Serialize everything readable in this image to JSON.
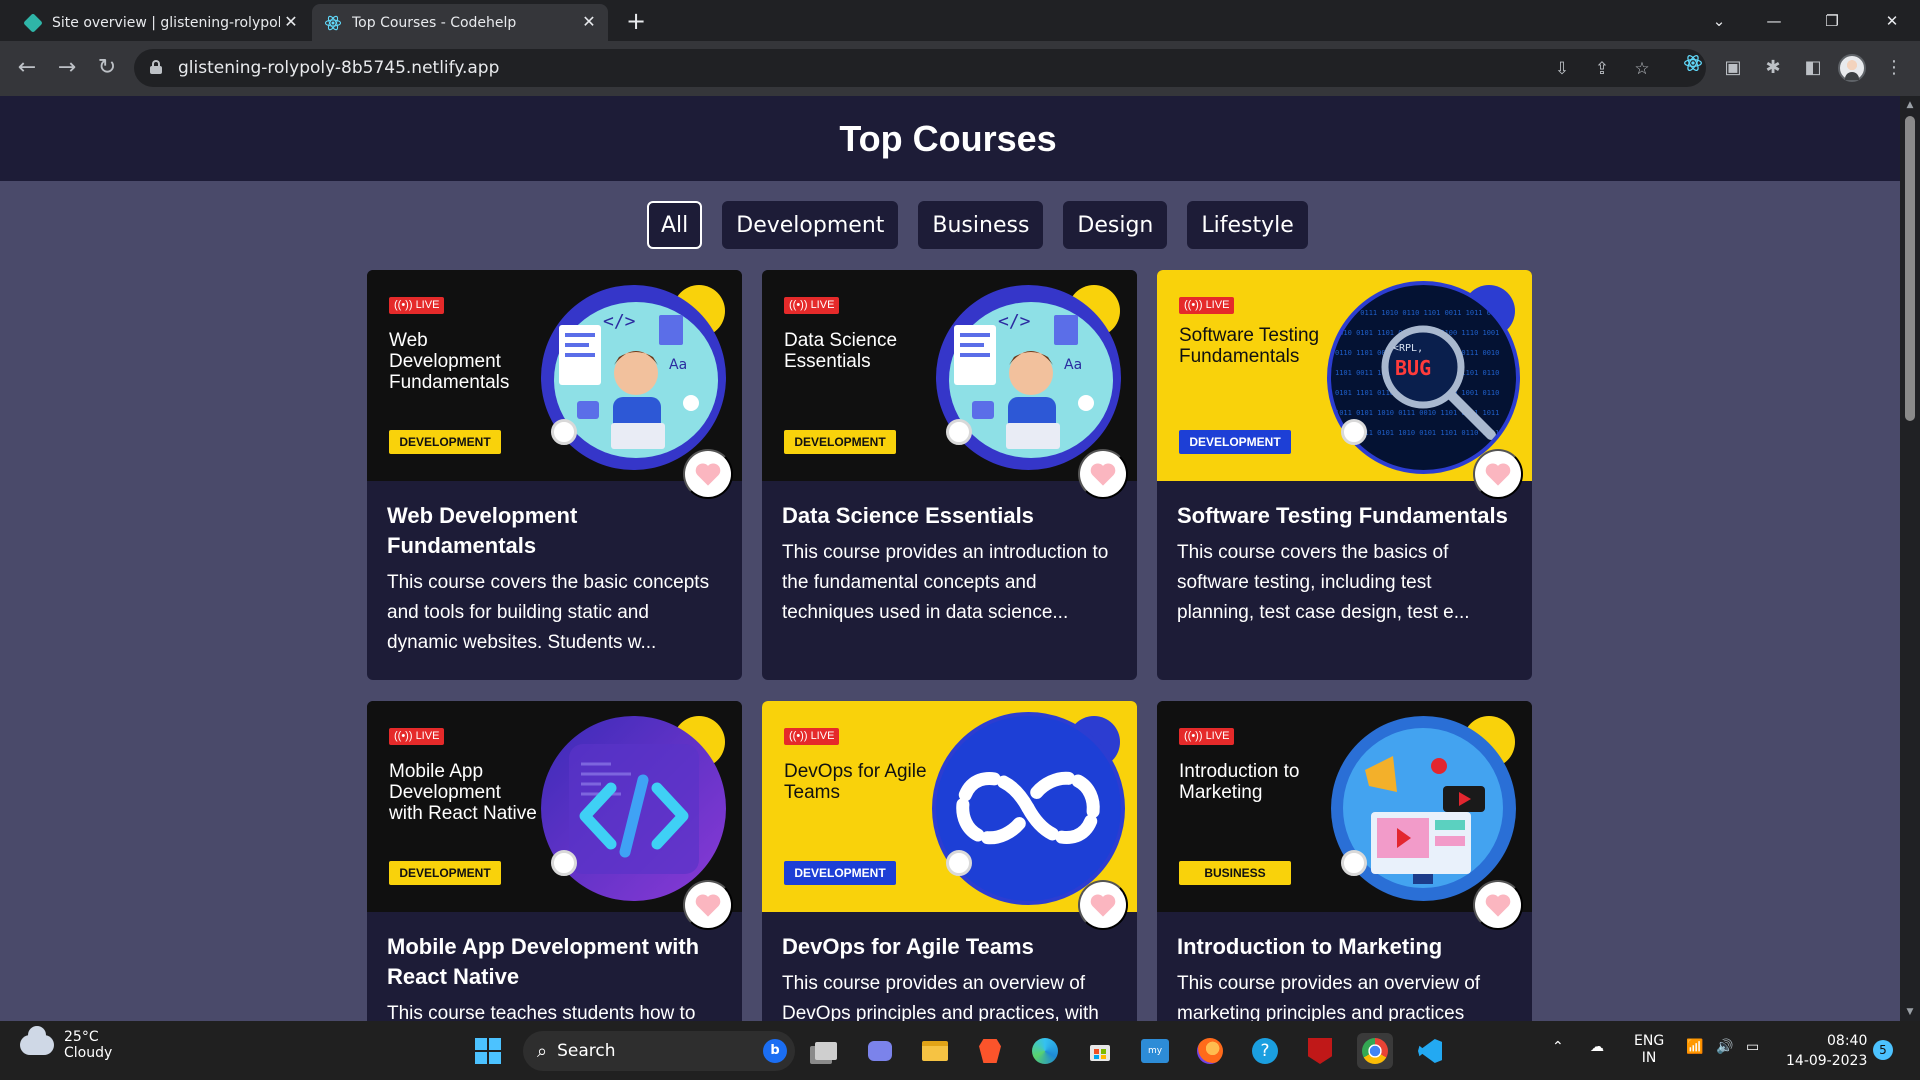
{
  "browser": {
    "tabs": [
      {
        "title": "Site overview | glistening-rolypol",
        "icon": "netlify-icon",
        "active": false
      },
      {
        "title": "Top Courses - Codehelp",
        "icon": "react-icon",
        "active": true
      }
    ],
    "url": "glistening-rolypoly-8b5745.netlify.app"
  },
  "page": {
    "title": "Top Courses",
    "filters": [
      {
        "label": "All",
        "active": true
      },
      {
        "label": "Development",
        "active": false
      },
      {
        "label": "Business",
        "active": false
      },
      {
        "label": "Design",
        "active": false
      },
      {
        "label": "Lifestyle",
        "active": false
      }
    ],
    "live_label": "LIVE",
    "courses": [
      {
        "thumb_title": "Web Development Fundamentals",
        "tag": "DEVELOPMENT",
        "theme": "dark",
        "art": "developer-illustration",
        "title": "Web Development Fundamentals",
        "description": "This course covers the basic concepts and tools for building static and dynamic websites. Students w..."
      },
      {
        "thumb_title": "Data Science Essentials",
        "tag": "DEVELOPMENT",
        "theme": "dark",
        "art": "developer-illustration",
        "title": "Data Science Essentials",
        "description": "This course provides an introduction to the fundamental concepts and techniques used in data science..."
      },
      {
        "thumb_title": "Software Testing Fundamentals",
        "tag": "DEVELOPMENT",
        "theme": "yellow",
        "art": "bug-magnifier",
        "title": "Software Testing Fundamentals",
        "description": "This course covers the basics of software testing, including test planning, test case design, test e..."
      },
      {
        "thumb_title": "Mobile App Development with React Native",
        "tag": "DEVELOPMENT",
        "theme": "dark",
        "art": "code-brackets",
        "title": "Mobile App Development with React Native",
        "description": "This course teaches students how to"
      },
      {
        "thumb_title": "DevOps for Agile Teams",
        "tag": "DEVELOPMENT",
        "theme": "yellow",
        "art": "infinity-loop",
        "title": "DevOps for Agile Teams",
        "description": "This course provides an overview of DevOps principles and practices, with"
      },
      {
        "thumb_title": "Introduction to Marketing",
        "tag": "BUSINESS",
        "theme": "dark",
        "art": "marketing-illustration",
        "title": "Introduction to Marketing",
        "description": "This course provides an overview of marketing principles and practices"
      }
    ]
  },
  "taskbar": {
    "weather_temp": "25°C",
    "weather_desc": "Cloudy",
    "search_label": "Search",
    "lang_top": "ENG",
    "lang_bottom": "IN",
    "time": "08:40",
    "date": "14-09-2023",
    "notification_count": "5"
  },
  "colors": {
    "page_bg": "#4a4a6a",
    "header_bg": "#1d1c37",
    "card_bg": "#1d1c37",
    "accent_yellow": "#f9d20b",
    "accent_blue": "#2c3dd1",
    "live_red": "#e52a2a"
  }
}
